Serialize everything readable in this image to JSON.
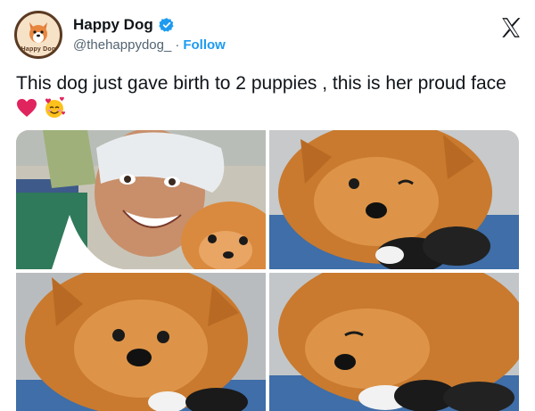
{
  "account": {
    "display_name": "Happy Dog",
    "handle": "@thehappydog_",
    "separator": "·",
    "follow_label": "Follow",
    "avatar_ring_text": "Happy Dog"
  },
  "tweet": {
    "text": "This dog just gave birth to 2 puppies , this is her proud face"
  },
  "media": {
    "count": 4,
    "photos": [
      {
        "label": "Smiling woman in surgical cap hugging Pomeranian"
      },
      {
        "label": "Pomeranian winking next to newborn puppies"
      },
      {
        "label": "Pomeranian close-up face"
      },
      {
        "label": "Pomeranian resting head over puppies"
      }
    ]
  },
  "icons": {
    "verified": "verified-badge-icon",
    "close": "x-logo-icon",
    "heart": "red-heart-emoji",
    "face": "smiling-face-with-hearts-emoji"
  },
  "colors": {
    "link": "#1d9bf0",
    "secondary_text": "#536471",
    "heart": "#e0245e"
  }
}
